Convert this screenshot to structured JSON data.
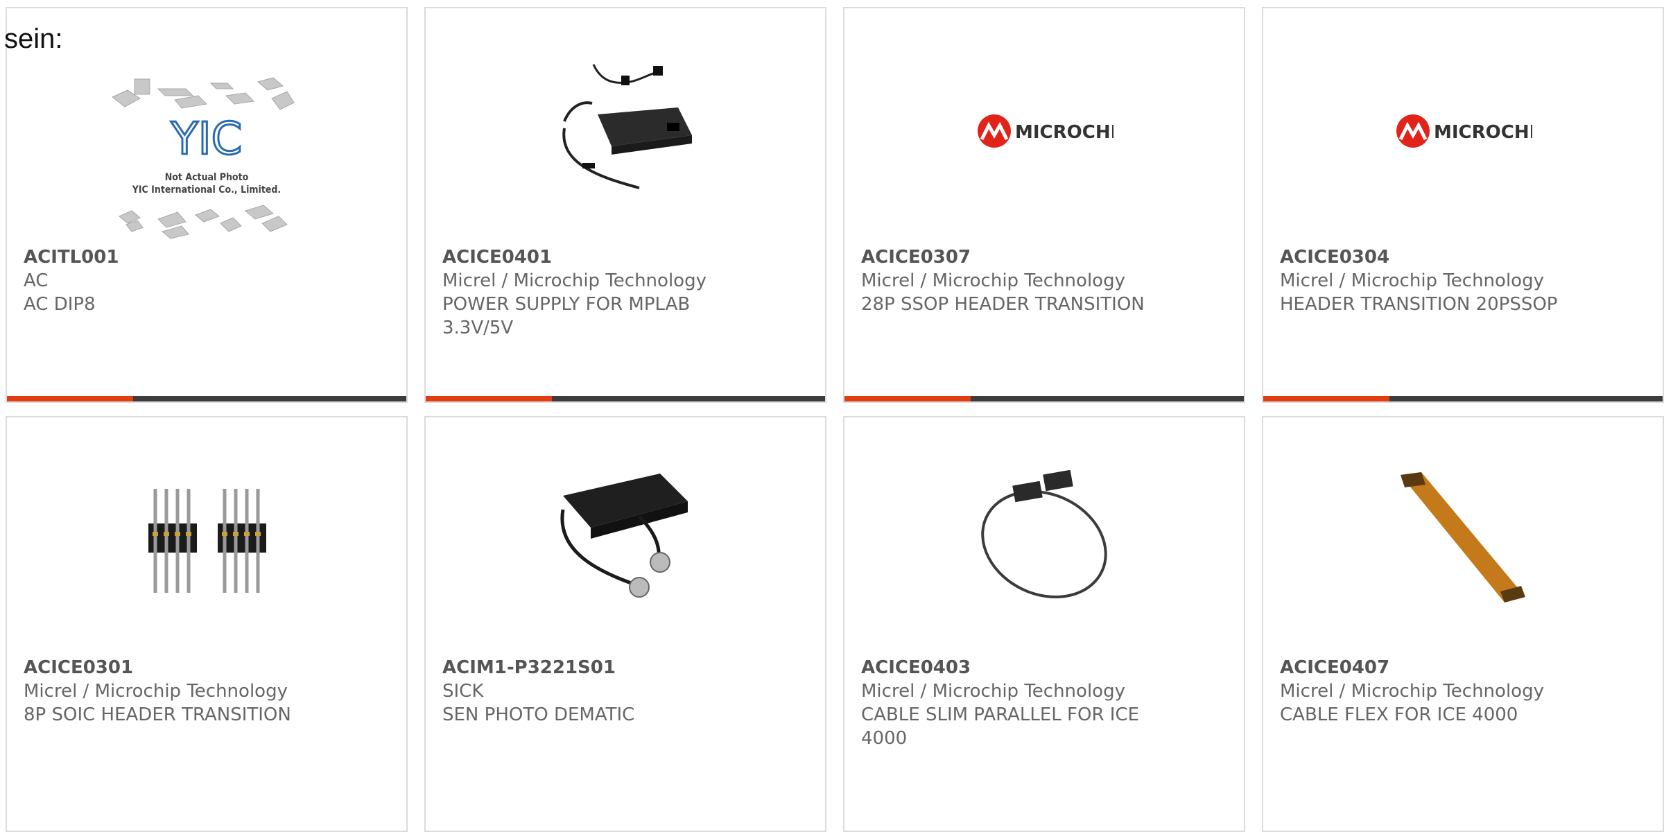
{
  "intro_text": "sein:",
  "colors": {
    "accent": "#e23d11",
    "bar": "#3c3c3c",
    "border": "#dcdcdc",
    "microchip_red": "#e2231a"
  },
  "products": [
    {
      "part": "ACITL001",
      "manufacturer": "AC",
      "description": "AC DIP8",
      "image": "yic-placeholder-image",
      "placeholder_lines": [
        "Not Actual Photo",
        "YIC International Co., Limited."
      ],
      "logo_text": "YIC"
    },
    {
      "part": "ACICE0401",
      "manufacturer": "Micrel / Microchip Technology",
      "description": "POWER SUPPLY FOR MPLAB 3.3V/5V",
      "image": "power-supply-image"
    },
    {
      "part": "ACICE0307",
      "manufacturer": "Micrel / Microchip Technology",
      "description": "28P SSOP HEADER TRANSITION",
      "image": "microchip-logo",
      "logo_text": "MICROCHIP"
    },
    {
      "part": "ACICE0304",
      "manufacturer": "Micrel / Microchip Technology",
      "description": "HEADER TRANSITION 20PSSOP",
      "image": "microchip-logo",
      "logo_text": "MICROCHIP"
    },
    {
      "part": "ACICE0301",
      "manufacturer": "Micrel / Microchip Technology",
      "description": "8P SOIC HEADER TRANSITION",
      "image": "pin-header-image"
    },
    {
      "part": "ACIM1-P3221S01",
      "manufacturer": "SICK",
      "description": "SEN PHOTO DEMATIC",
      "image": "sensor-image"
    },
    {
      "part": "ACICE0403",
      "manufacturer": "Micrel / Microchip Technology",
      "description": "CABLE SLIM PARALLEL FOR ICE 4000",
      "image": "cable-image"
    },
    {
      "part": "ACICE0407",
      "manufacturer": "Micrel / Microchip Technology",
      "description": "CABLE FLEX FOR ICE 4000",
      "image": "flex-cable-image"
    }
  ]
}
